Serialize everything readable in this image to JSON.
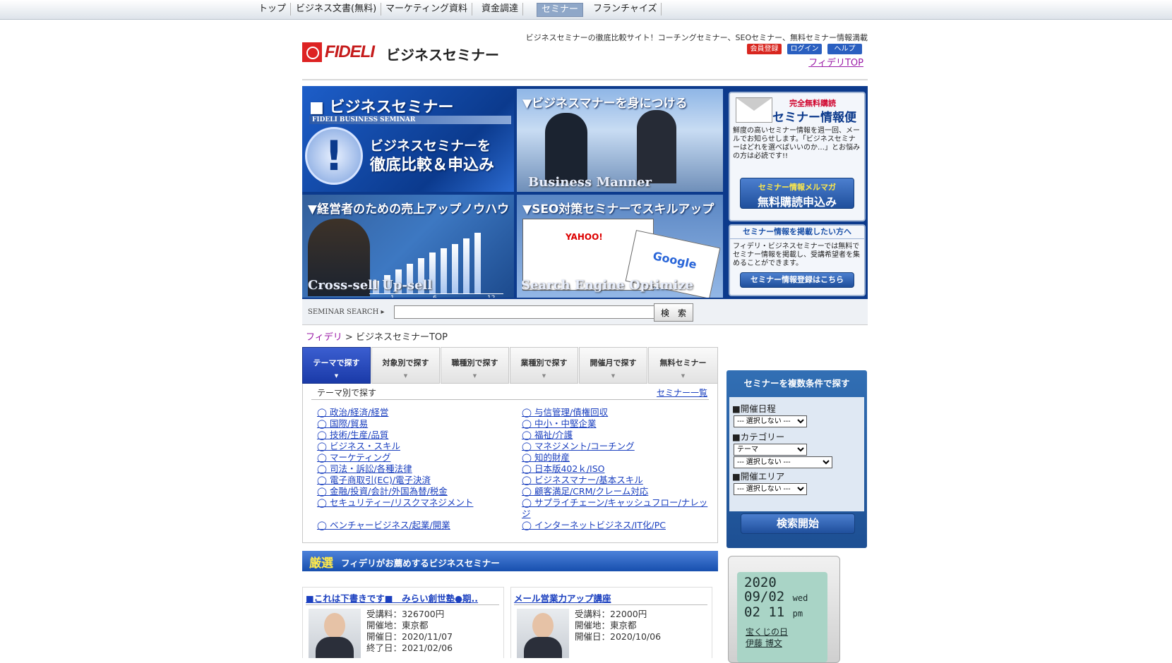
{
  "top_nav": [
    "トップ",
    "ビジネス文書(無料)",
    "マーケティング資料",
    "資金調達",
    "セミナー",
    "フランチャイズ"
  ],
  "header": {
    "logo_text": "FIDELI",
    "logo_sub": "ビジネスセミナー",
    "tagline": "ビジネスセミナーの徹底比較サイト！コーチングセミナー、SEOセミナー、無料セミナー情報満載",
    "btn_register": "会員登録",
    "btn_login": "ログイン",
    "btn_help": "ヘルプ",
    "top_link": "フィデリTOP"
  },
  "banner": {
    "main_title": "■ ビジネスセミナー",
    "main_subband": "FIDELI BUSINESS SEMINAR",
    "main_cta_1": "ビジネスセミナーを",
    "main_cta_2": "徹底比較＆申込み",
    "manner_title": "▼ビジネスマナーを身につける",
    "manner_caption": "Business Manner",
    "sales_title": "▼経営者のための売上アップノウハウ",
    "sales_caption": "Cross-sell  Up-sell",
    "sales_axis": [
      "1",
      "6",
      "12"
    ],
    "seo_title": "▼SEO対策セミナーでスキルアップ",
    "seo_caption": "Search Engine Optimize",
    "seo_logos": [
      "YAHOO!",
      "Google"
    ],
    "mail_head_1": "完全無料購読",
    "mail_head_2": "セミナー情報便",
    "mail_body": "鮮度の高いセミナー情報を週一回、メールでお知らせします。「ビジネスセミナーはどれを選べばいいのか…」とお悩みの方は必読です!!",
    "mail_btn_1": "セミナー情報メルマガ",
    "mail_btn_2": "無料購読申込み",
    "post_head": "セミナー情報を掲載したい方へ",
    "post_body": "フィデリ・ビジネスセミナーでは無料でセミナー情報を掲載し、受講希望者を集めることができます。",
    "post_btn": "セミナー情報登録はこちら"
  },
  "search": {
    "label": "SEMINAR SEARCH ▸",
    "value": "",
    "button": "検　索"
  },
  "breadcrumb": {
    "home": "フィデリ",
    "sep": ">",
    "current": "ビジネスセミナーTOP"
  },
  "tabs": [
    "テーマで探す",
    "対象別で探す",
    "職種別で探す",
    "業種別で探す",
    "開催月で探す",
    "無料セミナー"
  ],
  "theme": {
    "heading": "テーマ別で探す",
    "all_link": "セミナー一覧",
    "left": [
      "◯ 政治/経済/経営",
      "◯ 国際/貿易",
      "◯ 技術/生産/品質",
      "◯ ビジネス・スキル",
      "◯ マーケティング",
      "◯ 司法・訴訟/各種法律",
      "◯ 電子商取引(EC)/電子決済",
      "◯ 金融/投資/会計/外国為替/税金",
      "◯ セキュリティー/リスクマネジメント",
      "",
      "◯ ベンチャービジネス/起業/開業"
    ],
    "right": [
      "◯ 与信管理/債権回収",
      "◯ 中小・中堅企業",
      "◯ 福祉/介護",
      "◯ マネジメント/コーチング",
      "◯ 知的財産",
      "◯ 日本版402ｋ/ISO",
      "◯ ビジネスマナー/基本スキル",
      "◯ 顧客満足/CRM/クレーム対応",
      "◯ サプライチェーン/キャッシュフロー/ナレッジ",
      "◯ インターネットビジネス/IT化/PC"
    ]
  },
  "featured": {
    "kanji": "厳選",
    "title": "フィデリがお薦めするビジネスセミナー"
  },
  "cards": [
    {
      "title": "■これは下書きです■　みらい創世塾●期..",
      "fee": "受講料：326700円",
      "place": "開催地：東京都",
      "date": "開催日：2020/11/07",
      "end": "終了日：2021/02/06"
    },
    {
      "title": "メール営業力アップ講座",
      "fee": "受講料：22000円",
      "place": "開催地：東京都",
      "date": "開催日：2020/10/06",
      "end": ""
    }
  ],
  "multi_search": {
    "title": "セミナーを複数条件で探す",
    "date_label": "■開催日程",
    "date_value": "--- 選択しない ---",
    "category_label": "■カテゴリー",
    "category_value": "テーマ",
    "category_sub_value": "--- 選択しない ---",
    "area_label": "■開催エリア",
    "area_value": "--- 選択しない ---",
    "button": "検索開始"
  },
  "clock": {
    "year": "2020",
    "date": "09/02",
    "weekday": "wed",
    "time": "02 11",
    "ampm": "pm",
    "event": "宝くじの日",
    "person": "伊藤 博文"
  },
  "colors": {
    "banner_blue": "#0c3a8c",
    "tab_active": "#2a4bbe",
    "link": "#1a3fbf",
    "visited_link": "#9a1aa6",
    "register_red": "#d8261f"
  }
}
